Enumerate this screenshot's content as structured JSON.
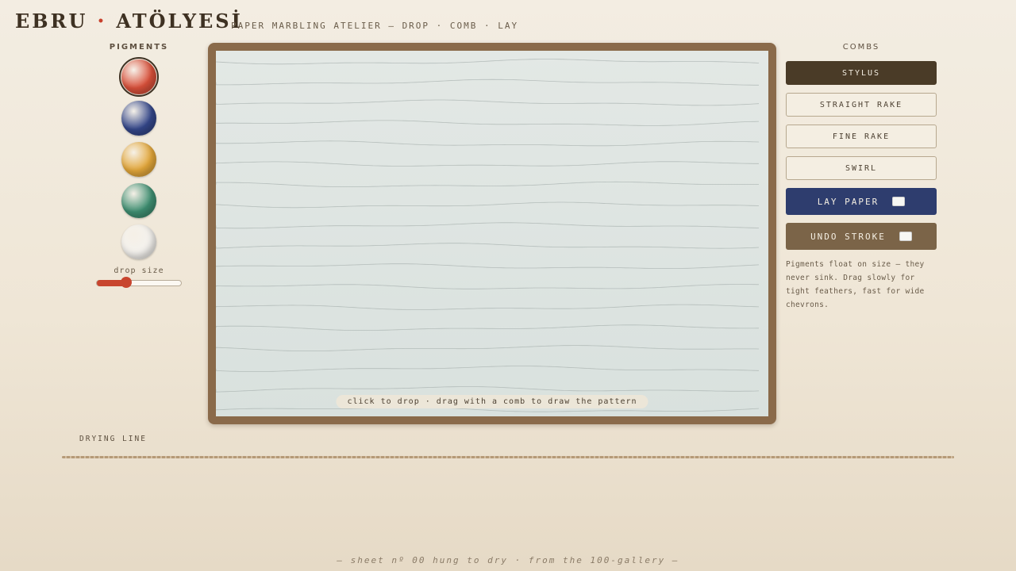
{
  "header": {
    "brand_left": "EBRU",
    "brand_dot": "•",
    "brand_right": "ATÖLYESİ",
    "subtitle": "PAPER MARBLING ATELIER — DROP · COMB · LAY"
  },
  "pigments": {
    "label": "PIGMENTS",
    "swatches": [
      {
        "color": "#d9503a",
        "selected": true
      },
      {
        "color": "#34478a",
        "selected": false
      },
      {
        "color": "#e3a73a",
        "selected": false
      },
      {
        "color": "#3f8f72",
        "selected": false
      },
      {
        "color": "#f4f2ee",
        "selected": false
      }
    ],
    "drop_size_label": "drop size",
    "drop_size_fraction": 0.35
  },
  "tray": {
    "hint": "click to drop · drag with a comb to draw the pattern"
  },
  "combs": {
    "label": "COMBS",
    "tools": [
      {
        "label": "STYLUS",
        "active": true
      },
      {
        "label": "STRAIGHT RAKE",
        "active": false
      },
      {
        "label": "FINE RAKE",
        "active": false
      },
      {
        "label": "SWIRL",
        "active": false
      }
    ],
    "lay_paper_label": "LAY PAPER",
    "undo_label": "UNDO STROKE",
    "note": "Pigments float on size — they never sink. Drag slowly for tight feathers, fast for wide chevrons."
  },
  "drying": {
    "label": "DRYING LINE"
  },
  "footer": {
    "text": "— sheet nº 00 hung to dry · from the 100-gallery —"
  },
  "colors": {
    "accent_red": "#c8452e",
    "lay_blue": "#2e3d6e",
    "undo_brown": "#7b6448",
    "frame_wood": "#8a6a4a",
    "active_dark": "#4a3b27"
  }
}
